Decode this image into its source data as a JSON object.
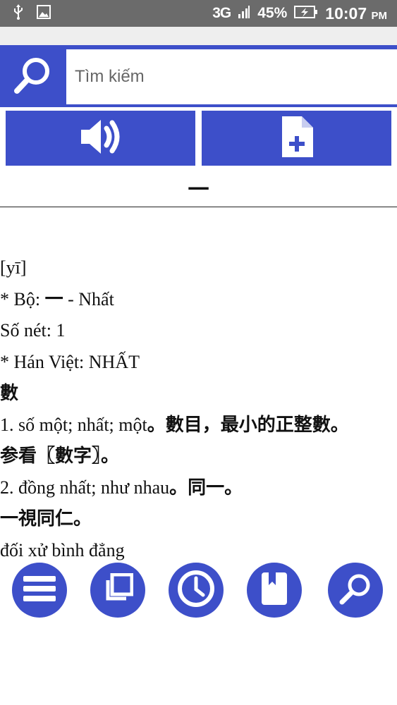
{
  "status_bar": {
    "network": "3G",
    "battery": "45%",
    "time": "10:07",
    "ampm": "PM"
  },
  "search": {
    "placeholder": "Tìm kiếm",
    "value": ""
  },
  "entry": {
    "headword": "一",
    "lines": [
      {
        "text": "[yī]",
        "cjk": ""
      },
      {
        "text": "* Bộ: ",
        "cjk": "一",
        "text_after": " - Nhất"
      },
      {
        "text": "Số nét: 1",
        "cjk": ""
      },
      {
        "text": "* Hán Việt: NHẤT",
        "cjk": ""
      },
      {
        "text": "",
        "cjk": "數"
      },
      {
        "text": "1. số một; nhất; một",
        "cjk": "。數目，最小的正整數。"
      },
      {
        "text": "",
        "cjk": "参看〖數字〗。"
      },
      {
        "text": "2. đồng nhất; như nhau",
        "cjk": "。同一。"
      },
      {
        "text": "",
        "cjk": "一視同仁。"
      },
      {
        "text": "đối xử bình đẳng",
        "cjk": ""
      }
    ]
  },
  "icons": {
    "search": "magnifier-icon",
    "speaker": "speaker-icon",
    "add_note": "file-plus-icon",
    "menu": "menu-icon",
    "copy": "copy-icon",
    "history": "clock-icon",
    "bookmark": "bookmark-icon",
    "search_nav": "magnifier-icon"
  },
  "colors": {
    "accent": "#3d4fc9",
    "status_bar": "#6b6b6b"
  }
}
